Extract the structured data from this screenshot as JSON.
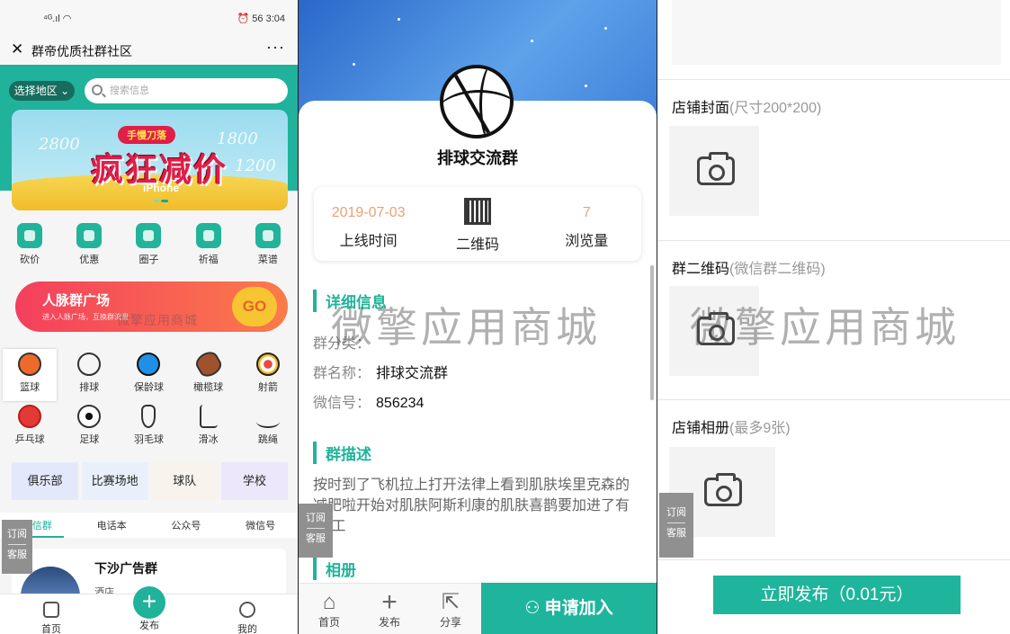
{
  "panel1": {
    "status": {
      "signal": "⁴ᴳ.ıl ◠",
      "right": "⏰ 56 3:04"
    },
    "title": "群帝优质社群社区",
    "region": "选择地区",
    "search_placeholder": "搜索信息",
    "banner": {
      "tag": "手慢刀落",
      "headline": "疯狂减价",
      "product": "iPhone",
      "prices": [
        "2800",
        "1800",
        "1200"
      ]
    },
    "quick": [
      "砍价",
      "优惠",
      "圈子",
      "祈福",
      "菜谱"
    ],
    "promo": {
      "title": "人脉群广场",
      "subtitle": "进入人脉广场，互换群流量",
      "go": "GO"
    },
    "sports_row1": [
      "篮球",
      "排球",
      "保龄球",
      "橄榄球",
      "射箭"
    ],
    "sports_row2": [
      "乒乓球",
      "足球",
      "羽毛球",
      "滑冰",
      "跳绳"
    ],
    "categories": [
      "俱乐部",
      "比赛场地",
      "球队",
      "学校"
    ],
    "category_colors": [
      "#e3e8fb",
      "#e9f0fb",
      "#f8f3ec",
      "#ece7fb"
    ],
    "tabs": [
      "微信群",
      "电话本",
      "公众号",
      "微信号"
    ],
    "card": {
      "name": "下沙广告群",
      "sub": "酒店"
    },
    "tabbar": [
      "首页",
      "发布",
      "我的"
    ],
    "side": {
      "a": "订阅",
      "b": "客服"
    }
  },
  "panel2": {
    "group_name": "排球交流群",
    "stats": [
      {
        "value": "2019-07-03",
        "label": "上线时间"
      },
      {
        "value": "",
        "label": "二维码"
      },
      {
        "value": "7",
        "label": "浏览量"
      }
    ],
    "detail_title": "详细信息",
    "fields": [
      {
        "k": "群分类：",
        "v": ""
      },
      {
        "k": "群名称：",
        "v": "排球交流群"
      },
      {
        "k": "微信号：",
        "v": "856234"
      }
    ],
    "desc_title": "群描述",
    "desc": "按时到了飞机拉上打开法律上看到肌肤埃里克森的减肥啦开始对肌肤阿斯利康的肌肤喜鹊要加进了有哩 工",
    "album_title": "相册",
    "bottom": [
      "首页",
      "发布",
      "分享"
    ],
    "join": "申请加入",
    "side": {
      "a": "订阅",
      "b": "客服"
    }
  },
  "panel3": {
    "cover_label": "店铺封面",
    "cover_hint": "(尺寸200*200)",
    "qr_label": "群二维码",
    "qr_hint": "(微信群二维码)",
    "album_label": "店铺相册",
    "album_hint": "(最多9张)",
    "publish": "立即发布（0.01元）",
    "side": {
      "a": "订阅",
      "b": "客服"
    }
  },
  "watermark": "微擎应用商城",
  "accent": "#1fb59c"
}
